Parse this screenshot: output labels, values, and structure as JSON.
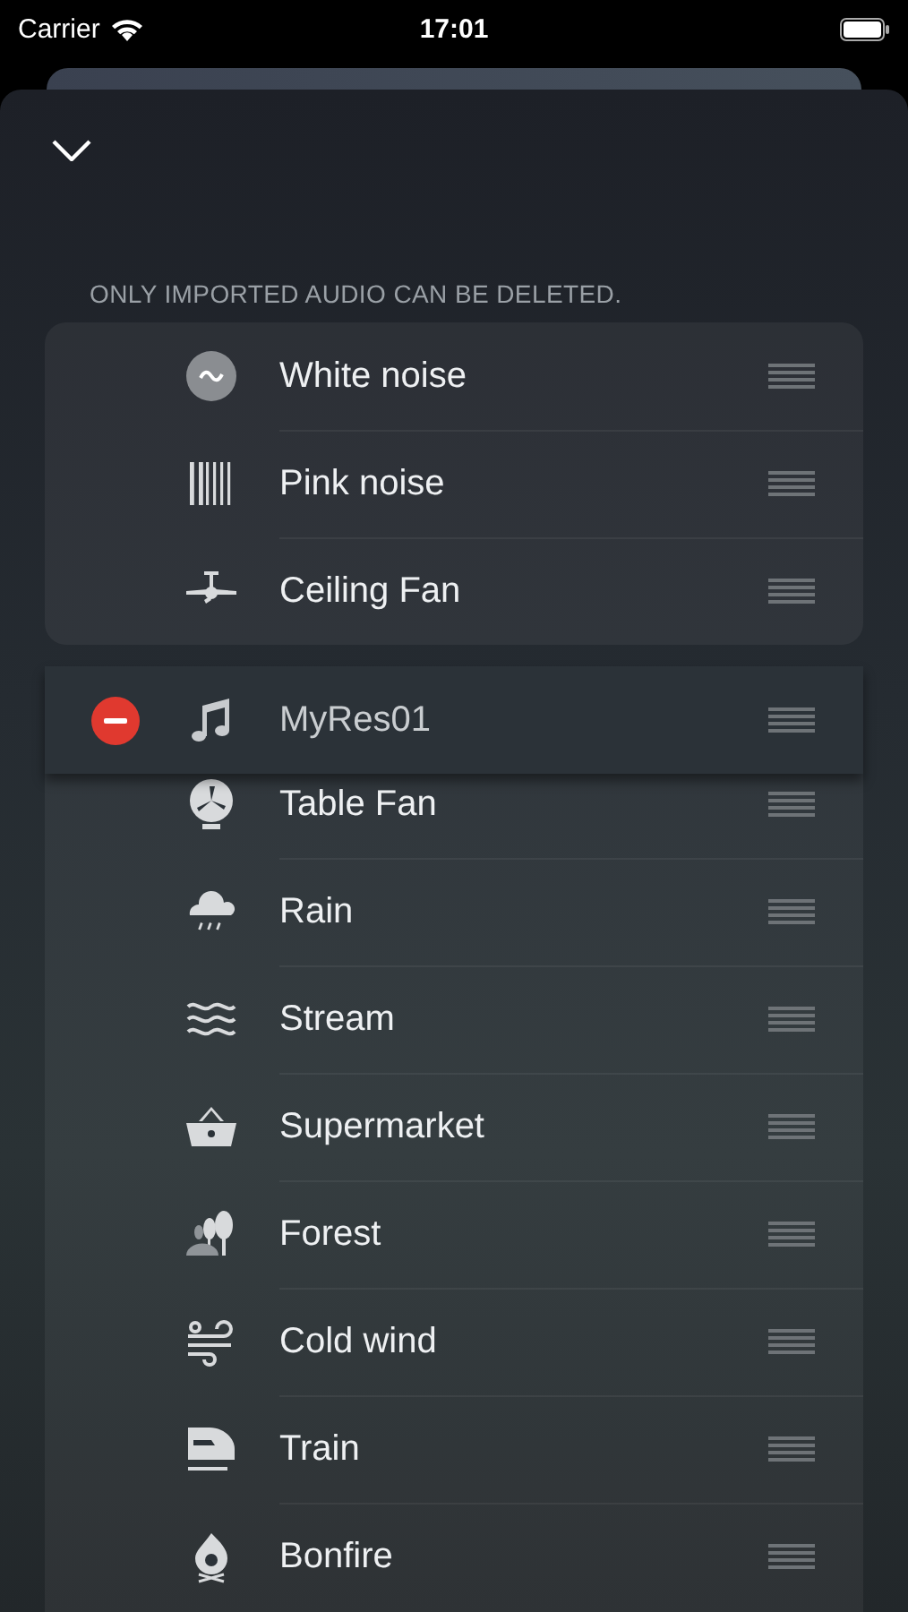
{
  "status_bar": {
    "carrier": "Carrier",
    "time": "17:01"
  },
  "section_header": "ONLY IMPORTED AUDIO CAN BE DELETED.",
  "sounds": [
    {
      "name": "White noise",
      "deletable": false,
      "dragging": false
    },
    {
      "name": "Pink noise",
      "deletable": false,
      "dragging": false
    },
    {
      "name": "Ceiling Fan",
      "deletable": false,
      "dragging": false
    },
    {
      "name": "MyRes01",
      "deletable": true,
      "dragging": true
    },
    {
      "name": "Table Fan",
      "deletable": false,
      "dragging": false
    },
    {
      "name": "Rain",
      "deletable": false,
      "dragging": false
    },
    {
      "name": "Stream",
      "deletable": false,
      "dragging": false
    },
    {
      "name": "Supermarket",
      "deletable": false,
      "dragging": false
    },
    {
      "name": "Forest",
      "deletable": false,
      "dragging": false
    },
    {
      "name": "Cold wind",
      "deletable": false,
      "dragging": false
    },
    {
      "name": "Train",
      "deletable": false,
      "dragging": false
    },
    {
      "name": "Bonfire",
      "deletable": false,
      "dragging": false
    }
  ]
}
